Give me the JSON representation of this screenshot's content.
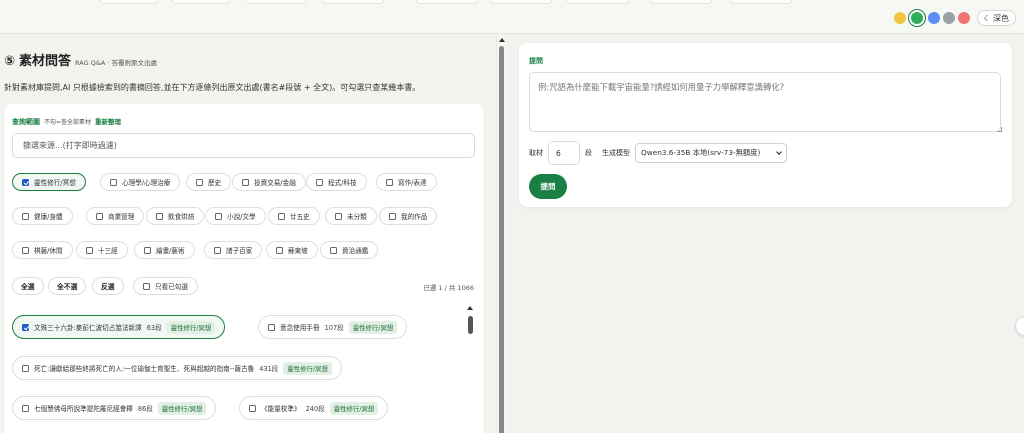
{
  "theme": {
    "colors": [
      "#f4c542",
      "#2fae5a",
      "#5b8ef0",
      "#9aa0a6",
      "#f07474"
    ],
    "active_index": 1,
    "dark_label": "深色",
    "dark_icon": "moon-icon"
  },
  "section": {
    "number": "⑤",
    "title": "素材問答",
    "subtitle": "RAG Q&A · 答覆附原文出處",
    "intro": "針對素材庫提問,AI 只根據檢索到的書摘回答,並在下方逐條列出原文出處(書名#段號 + 全文)。可勾選只查某幾本書。"
  },
  "scope": {
    "label": "查詢範圍",
    "hint": "不勾=查全部素材",
    "reset": "重新整理",
    "filter_placeholder": "篩選來源...(打字即時過濾)"
  },
  "categories": [
    {
      "label": "靈性修行/冥想",
      "checked": true
    },
    {
      "label": "心理學/心理治療",
      "checked": false
    },
    {
      "label": "歷史",
      "checked": false
    },
    {
      "label": "投資交易/金融",
      "checked": false
    },
    {
      "label": "程式/科技",
      "checked": false
    },
    {
      "label": "寫作/表達",
      "checked": false
    },
    {
      "label": "健康/身體",
      "checked": false
    },
    {
      "label": "商業管理",
      "checked": false
    },
    {
      "label": "飲食烘焙",
      "checked": false
    },
    {
      "label": "小說/文學",
      "checked": false
    },
    {
      "label": "廿五史",
      "checked": false
    },
    {
      "label": "未分類",
      "checked": false
    },
    {
      "label": "我的作品",
      "checked": false
    },
    {
      "label": "棋藝/休閒",
      "checked": false
    },
    {
      "label": "十三經",
      "checked": false
    },
    {
      "label": "繪畫/藝術",
      "checked": false
    },
    {
      "label": "諸子百家",
      "checked": false
    },
    {
      "label": "蘇東坡",
      "checked": false
    },
    {
      "label": "資治通鑑",
      "checked": false
    }
  ],
  "actions": {
    "select_all": "全選",
    "select_none": "全不選",
    "invert": "反選",
    "only_checked": "只看已勾選",
    "count": "已選 1 / 共 1066"
  },
  "docs": [
    {
      "title": "文殊三十六卦:麥彭仁波切占筮法新譯",
      "count": "63段",
      "tag": "靈性修行/冥想",
      "checked": true
    },
    {
      "title": "意念使用手冊",
      "count": "107段",
      "tag": "靈性修行/冥想",
      "checked": false
    },
    {
      "title": "死亡:讓獻給那些終將死亡的人:一位瑜伽士育聖生、死與超越的指南--薩古魯",
      "count": "431段",
      "tag": "靈性修行/冥想",
      "checked": false
    },
    {
      "title": "七個慧佛母所說準提陀羅尼經會釋",
      "count": "86段",
      "tag": "靈性修行/冥想",
      "checked": false
    },
    {
      "title": "《能量校準》",
      "count": "240段",
      "tag": "靈性修行/冥想",
      "checked": false
    }
  ],
  "ask": {
    "label": "提問",
    "placeholder": "例:咒語為什麼能下載宇宙能量?請經如何用量子力學解釋意識轉化?",
    "take_label": "取材",
    "take_value": "6",
    "unit": "段",
    "model_label": "生成模型",
    "model_value": "Qwen3.6-35B 本地(srv-73-無額度)",
    "submit": "提問"
  }
}
